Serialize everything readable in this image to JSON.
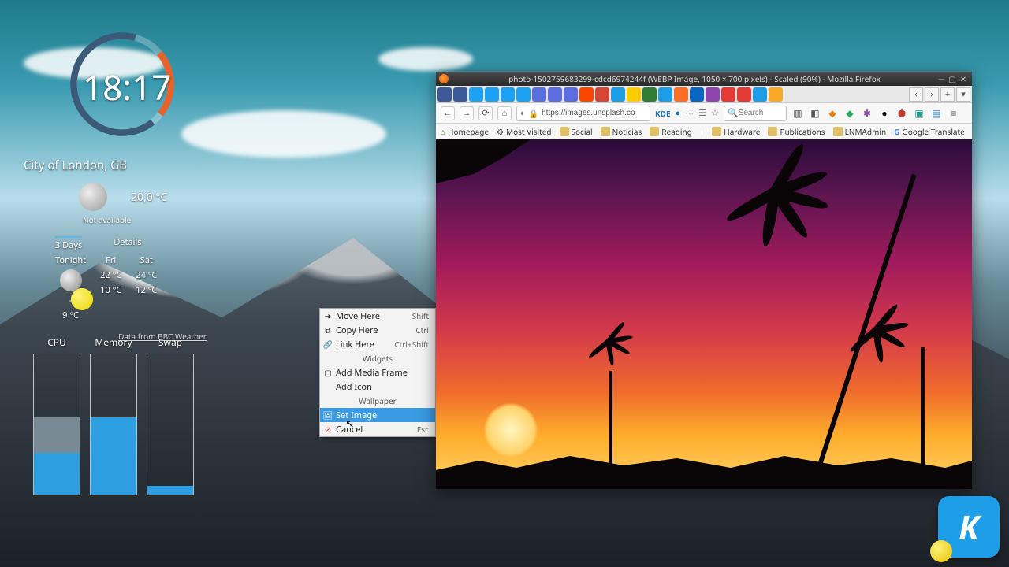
{
  "clock": {
    "time": "18:17"
  },
  "weather": {
    "location": "City of London, GB",
    "now_temp": "20,0 °C",
    "now_status": "Not available",
    "tab_days": "3 Days",
    "tab_details": "Details",
    "days": [
      {
        "label": "Tonight",
        "hi": "-",
        "lo": "9 °C",
        "icon": "moon"
      },
      {
        "label": "Fri",
        "hi": "22 °C",
        "lo": "10 °C",
        "icon": "sun"
      },
      {
        "label": "Sat",
        "hi": "24 °C",
        "lo": "12 °C",
        "icon": "sun"
      }
    ],
    "attribution": "Data from BBC Weather"
  },
  "sysmon": {
    "cpu": {
      "label": "CPU",
      "used_pct": 30,
      "cached_pct": 25
    },
    "memory": {
      "label": "Memory",
      "used_pct": 55,
      "cached_pct": 0
    },
    "swap": {
      "label": "Swap",
      "used_pct": 6,
      "cached_pct": 0
    }
  },
  "context_menu": {
    "move": {
      "label": "Move Here",
      "shortcut": "Shift"
    },
    "copy": {
      "label": "Copy Here",
      "shortcut": "Ctrl"
    },
    "link": {
      "label": "Link Here",
      "shortcut": "Ctrl+Shift"
    },
    "header_widgets": "Widgets",
    "add_frame": {
      "label": "Add Media Frame"
    },
    "add_icon": {
      "label": "Add Icon"
    },
    "header_wallpaper": "Wallpaper",
    "set_image": {
      "label": "Set Image"
    },
    "cancel": {
      "label": "Cancel",
      "shortcut": "Esc"
    }
  },
  "firefox": {
    "title": "photo-1502759683299-cdcd6974244f (WEBP Image, 1050 × 700 pixels) - Scaled (90%) - Mozilla Firefox",
    "url_display": "https://images.unsplash.co",
    "kde_badge": "KDE",
    "search_placeholder": "Search",
    "bookmarks": [
      {
        "label": "Homepage",
        "icon": "home"
      },
      {
        "label": "Most Visited",
        "icon": "gear"
      },
      {
        "label": "Social",
        "icon": "folder"
      },
      {
        "label": "Noticias",
        "icon": "folder"
      },
      {
        "label": "Reading",
        "icon": "folder"
      },
      {
        "label": "Hardware",
        "icon": "folder"
      },
      {
        "label": "Publications",
        "icon": "folder"
      },
      {
        "label": "LNMAdmin",
        "icon": "folder"
      },
      {
        "label": "Google Translate",
        "icon": "g"
      }
    ],
    "tab_favicons": [
      {
        "c": "#3b5998"
      },
      {
        "c": "#3b5998"
      },
      {
        "c": "#1da1f2"
      },
      {
        "c": "#1da1f2"
      },
      {
        "c": "#1da1f2"
      },
      {
        "c": "#1da1f2"
      },
      {
        "c": "#5b6ee1"
      },
      {
        "c": "#5b6ee1"
      },
      {
        "c": "#5b6ee1"
      },
      {
        "c": "#ff4500"
      },
      {
        "c": "#d44638"
      },
      {
        "c": "#1e9de8"
      },
      {
        "c": "#ffcc00"
      },
      {
        "c": "#2e7d32"
      },
      {
        "c": "#1e9de8"
      },
      {
        "c": "#fc6d26"
      },
      {
        "c": "#0a66c2"
      },
      {
        "c": "#8e44ad"
      },
      {
        "c": "#e53935"
      },
      {
        "c": "#e53935"
      },
      {
        "c": "#1e9de8"
      },
      {
        "c": "#f9a825"
      }
    ]
  },
  "kde_logo_letter": "K"
}
